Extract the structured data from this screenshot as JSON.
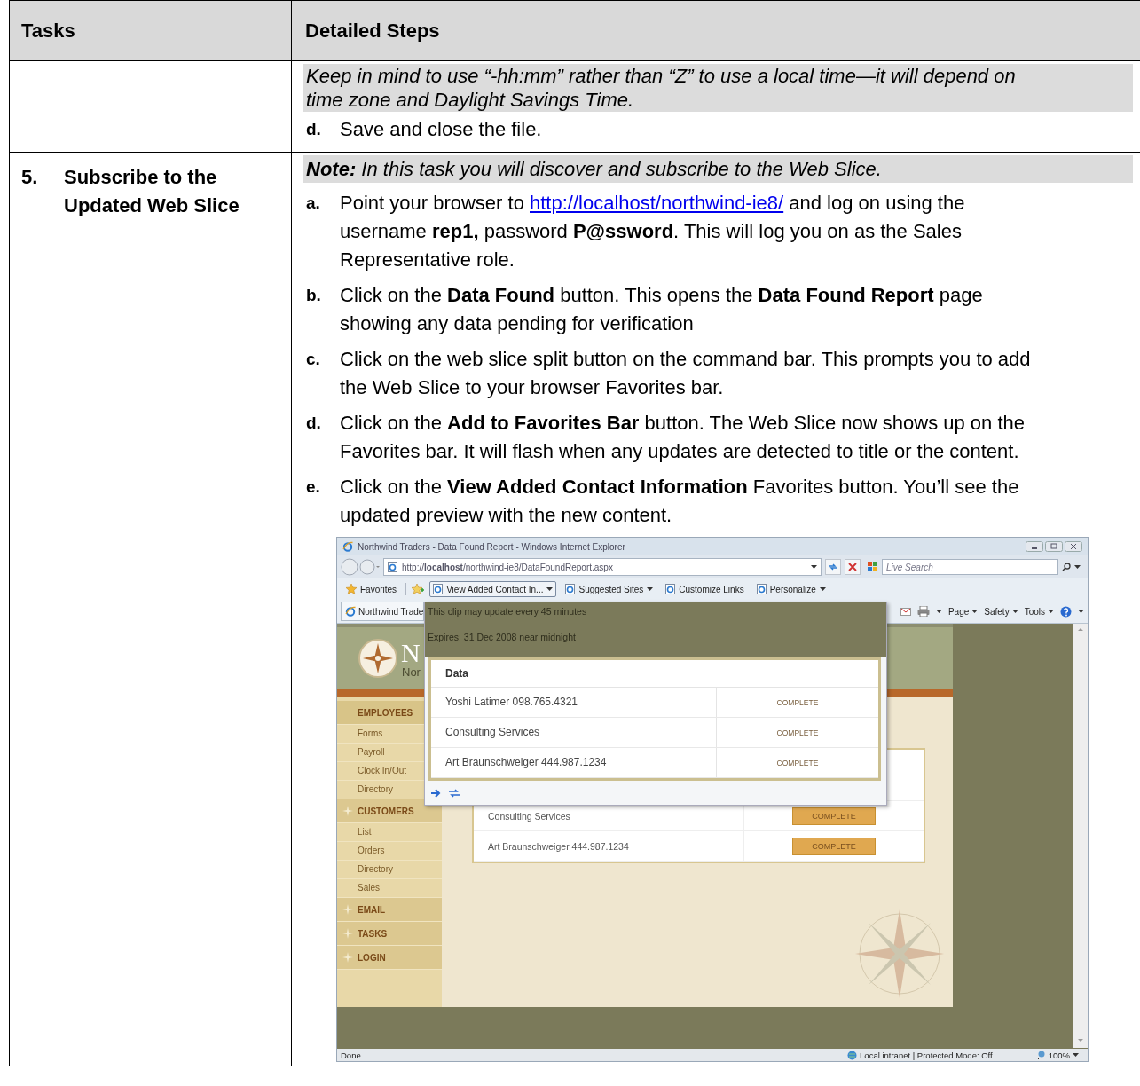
{
  "table": {
    "columns": [
      "Tasks",
      "Detailed Steps"
    ],
    "rows": [
      {
        "note": "Keep in mind to use “-hh:mm” rather than “Z” to use a local time—it will depend on time zone and Daylight Savings Time.",
        "steps": [
          {
            "letter": "d.",
            "text": "Save and close the file."
          }
        ]
      },
      {
        "task_number": "5.",
        "task": "Subscribe to the Updated Web Slice",
        "note": "**Note:** In this task you will discover and subscribe to the Web Slice.",
        "steps": [
          {
            "letter": "a.",
            "text": "Point your browser to",
            "link": "http://localhost/northwind-ie8/",
            "text_after": "and log on using the username **rep1,** password **P@ssword**. This will log you on as the Sales Representative role."
          },
          {
            "letter": "b.",
            "text": "Click on the **Data Found** button. This opens the **Data Found Report** page showing any data pending for verification"
          },
          {
            "letter": "c.",
            "text": "Click on the web slice split button on the command bar. This prompts you to add the Web Slice to your browser Favorites bar."
          },
          {
            "letter": "d.",
            "text": "Click on the **Add to Favorites Bar** button. The Web Slice now shows up on the Favorites bar. It will flash when any updates are detected to title or the content."
          },
          {
            "letter": "e.",
            "text": "Click on the **View Added Contact Information** Favorites button.  You’ll see the updated preview with the new content."
          }
        ],
        "screenshot": {
          "title": "Northwind Traders - Data Found Report - Windows Internet Explorer",
          "address": "http://**localhost**/northwind-ie8/DataFoundReport.aspx",
          "search": {
            "placeholder": "Live Search"
          },
          "favorites": [
            {
              "label": "Favorites",
              "kind": "star",
              "dropdown": false,
              "selected": false
            },
            {
              "label": "View Added Contact In...",
              "kind": "page",
              "dropdown": true,
              "selected": true
            },
            {
              "label": "Suggested Sites",
              "kind": "page",
              "dropdown": true,
              "selected": false
            },
            {
              "label": "Customize Links",
              "kind": "page",
              "dropdown": false,
              "selected": false
            },
            {
              "label": "Personalize",
              "kind": "page",
              "dropdown": true,
              "selected": false
            }
          ],
          "tab": "Northwind Trade",
          "commands": [
            "Page",
            "Safety",
            "Tools"
          ],
          "site": {
            "logo_letter": "N",
            "logo_sub": "Nor",
            "menu": [
              {
                "label": "EMPLOYEES",
                "selected": true,
                "children": [
                  {
                    "label": "Forms",
                    "selected": false
                  },
                  {
                    "label": "Payroll",
                    "selected": false
                  },
                  {
                    "label": "Clock In/Out",
                    "selected": false
                  },
                  {
                    "label": "Directory",
                    "selected": false
                  }
                ]
              },
              {
                "label": "CUSTOMERS",
                "selected": false,
                "children": [
                  {
                    "label": "List",
                    "selected": false
                  },
                  {
                    "label": "Orders",
                    "selected": false
                  },
                  {
                    "label": "Directory",
                    "selected": false
                  },
                  {
                    "label": "Sales",
                    "selected": false
                  }
                ]
              },
              {
                "label": "EMAIL",
                "selected": false
              },
              {
                "label": "TASKS",
                "selected": false
              },
              {
                "label": "LOGIN",
                "selected": false
              }
            ],
            "rows": [
              {
                "name": "Consulting Services",
                "action": "COMPLETE"
              },
              {
                "name": "Art Braunschweiger 444.987.1234",
                "action": "COMPLETE"
              }
            ]
          },
          "slice": {
            "update_note": "This clip may update every 45 minutes",
            "expires": "Expires: 31 Dec 2008 near midnight",
            "heading": "Data",
            "rows": [
              {
                "name": "Yoshi Latimer 098.765.4321",
                "status": "COMPLETE"
              },
              {
                "name": "Consulting Services",
                "status": "COMPLETE"
              },
              {
                "name": "Art Braunschweiger 444.987.1234",
                "status": "COMPLETE"
              }
            ]
          },
          "status_bar": {
            "text": "Done",
            "zone": "Local intranet | Protected Mode: Off",
            "zoom": "100%"
          }
        }
      }
    ]
  }
}
